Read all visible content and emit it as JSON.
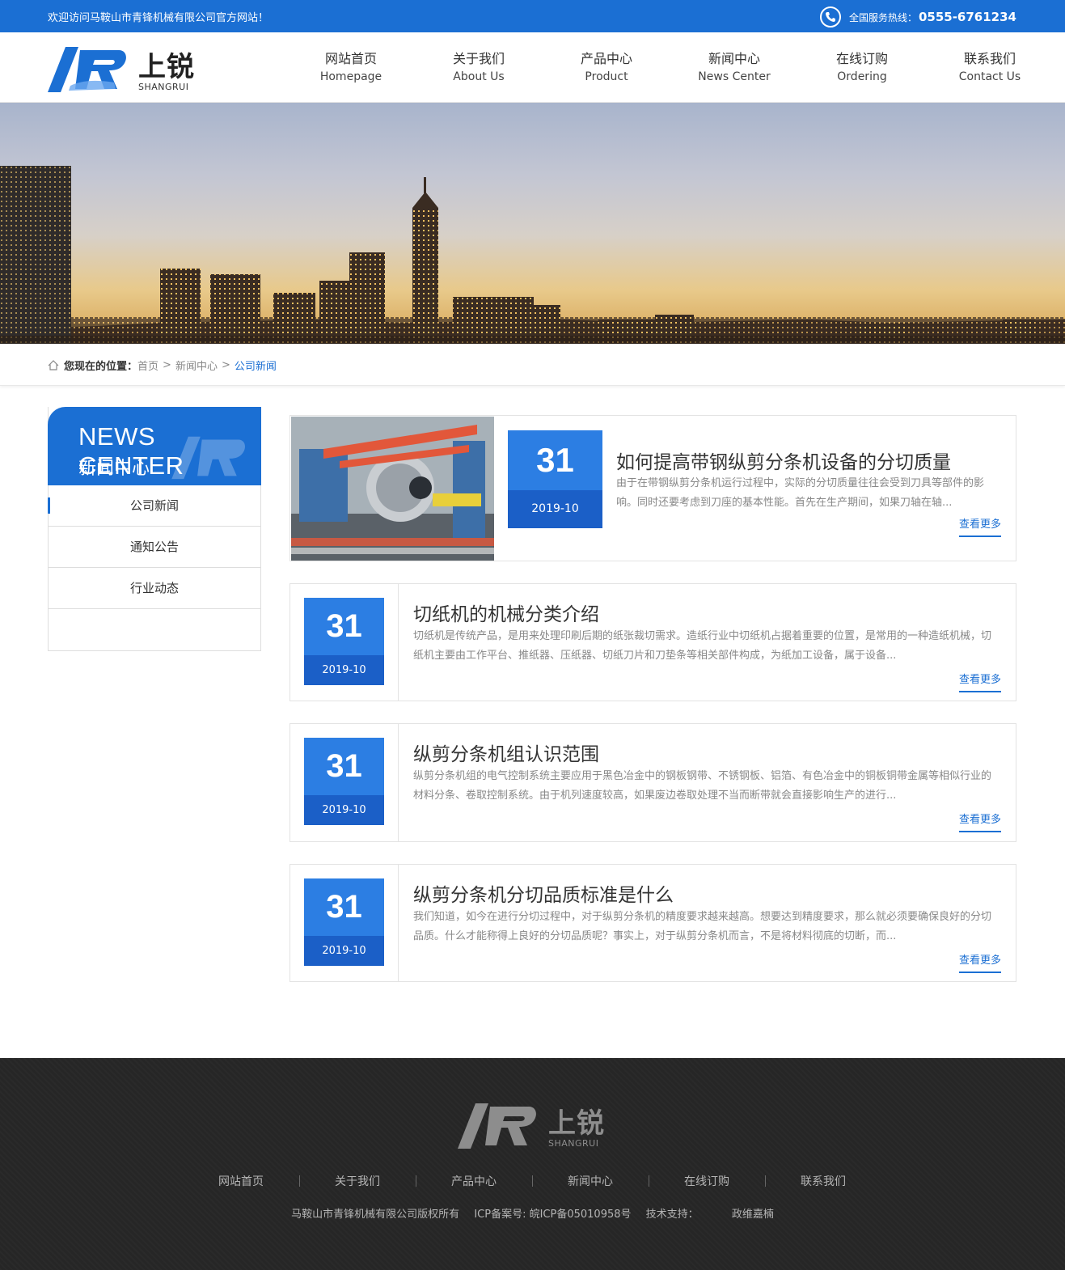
{
  "topbar": {
    "welcome": "欢迎访问马鞍山市青锋机械有限公司官方网站！",
    "hotline_label": "全国服务热线：",
    "hotline_number": "0555-6761234"
  },
  "logo": {
    "cn": "上锐",
    "en": "SHANGRUI",
    "mark": "SR"
  },
  "nav": [
    {
      "cn": "网站首页",
      "en": "Homepage"
    },
    {
      "cn": "关于我们",
      "en": "About Us"
    },
    {
      "cn": "产品中心",
      "en": "Product"
    },
    {
      "cn": "新闻中心",
      "en": "News Center"
    },
    {
      "cn": "在线订购",
      "en": "Ordering"
    },
    {
      "cn": "联系我们",
      "en": "Contact Us"
    }
  ],
  "breadcrumb": {
    "label": "您现在的位置：",
    "items": [
      "首页",
      "新闻中心"
    ],
    "separator": ">",
    "current": "公司新闻"
  },
  "sidebar": {
    "title_en": "NEWS CENTER",
    "title_cn": "新闻中心",
    "items": [
      "公司新闻",
      "通知公告",
      "行业动态"
    ]
  },
  "news": [
    {
      "day": "31",
      "ym": "2019-10",
      "title": "如何提高带钢纵剪分条机设备的分切质量",
      "desc": "由于在带钢纵剪分条机运行过程中，实际的分切质量往往会受到刀具等部件的影响。同时还要考虑到刀座的基本性能。首先在生产期间，如果刀轴在轴...",
      "more": "查看更多"
    },
    {
      "day": "31",
      "ym": "2019-10",
      "title": "切纸机的机械分类介绍",
      "desc": "切纸机是传统产品，是用来处理印刷后期的纸张裁切需求。造纸行业中切纸机占据着重要的位置，是常用的一种造纸机械，切纸机主要由工作平台、推纸器、压纸器、切纸刀片和刀垫条等相关部件构成，为纸加工设备，属于设备...",
      "more": "查看更多"
    },
    {
      "day": "31",
      "ym": "2019-10",
      "title": "纵剪分条机组认识范围",
      "desc": "纵剪分条机组的电气控制系统主要应用于黑色冶金中的钢板钢带、不锈钢板、铝箔、有色冶金中的铜板铜带金属等相似行业的材料分条、卷取控制系统。由于机列速度较高，如果废边卷取处理不当而断带就会直接影响生产的进行...",
      "more": "查看更多"
    },
    {
      "day": "31",
      "ym": "2019-10",
      "title": "纵剪分条机分切品质标准是什么",
      "desc": "我们知道，如今在进行分切过程中，对于纵剪分条机的精度要求越来越高。想要达到精度要求，那么就必须要确保良好的分切品质。什么才能称得上良好的分切品质呢？事实上，对于纵剪分条机而言，不是将材料彻底的切断，而...",
      "more": "查看更多"
    }
  ],
  "footer": {
    "nav": [
      "网站首页",
      "关于我们",
      "产品中心",
      "新闻中心",
      "在线订购",
      "联系我们"
    ],
    "copyright": "马鞍山市青锋机械有限公司版权所有",
    "icp": "ICP备案号: 皖ICP备05010958号",
    "support_label": "技术支持：",
    "support": "政维嘉楠"
  },
  "colors": {
    "primary": "#1b6fd3",
    "date_top": "#2c7ee3",
    "date_bottom": "#1b5fc7",
    "footer_bg": "#262626"
  },
  "icons": [
    "phone-icon",
    "home-icon"
  ]
}
